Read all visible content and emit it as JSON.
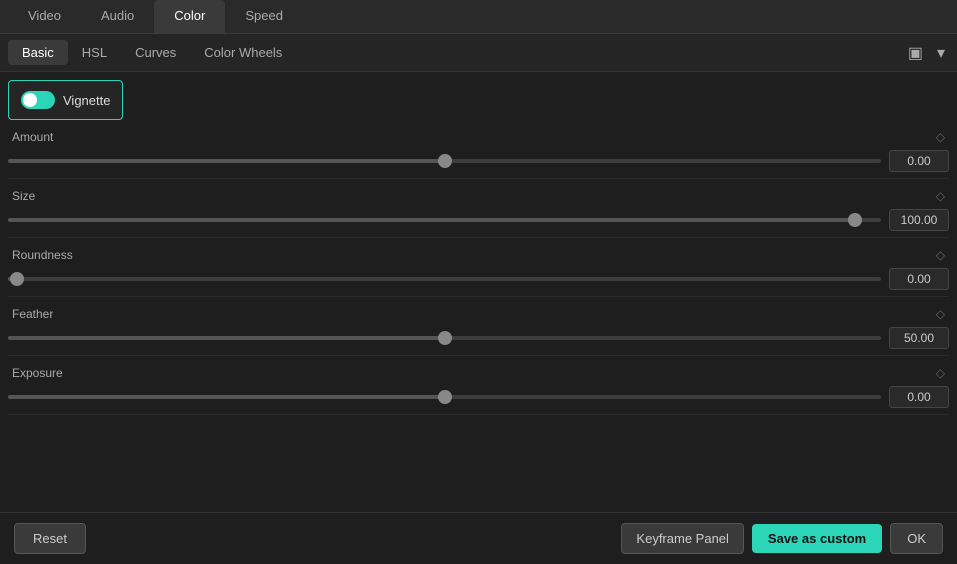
{
  "topTabs": {
    "items": [
      {
        "label": "Video",
        "active": false
      },
      {
        "label": "Audio",
        "active": false
      },
      {
        "label": "Color",
        "active": true
      },
      {
        "label": "Speed",
        "active": false
      }
    ]
  },
  "subTabs": {
    "items": [
      {
        "label": "Basic",
        "active": true
      },
      {
        "label": "HSL",
        "active": false
      },
      {
        "label": "Curves",
        "active": false
      },
      {
        "label": "Color Wheels",
        "active": false
      }
    ]
  },
  "vignette": {
    "label": "Vignette",
    "enabled": true
  },
  "sliders": [
    {
      "label": "Amount",
      "value": "0.00",
      "percent": 50
    },
    {
      "label": "Size",
      "value": "100.00",
      "percent": 97
    },
    {
      "label": "Roundness",
      "value": "0.00",
      "percent": 1
    },
    {
      "label": "Feather",
      "value": "50.00",
      "percent": 50
    },
    {
      "label": "Exposure",
      "value": "0.00",
      "percent": 50
    }
  ],
  "bottomBar": {
    "resetLabel": "Reset",
    "keyframeLabel": "Keyframe Panel",
    "saveCustomLabel": "Save as custom",
    "okLabel": "OK"
  }
}
